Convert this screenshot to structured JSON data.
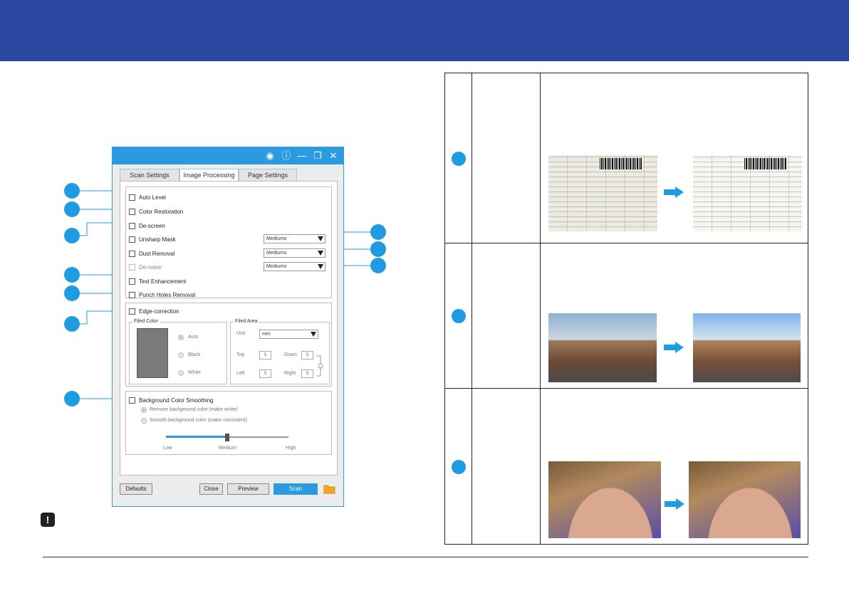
{
  "dialog": {
    "tabs": [
      "Scan Settings",
      "Image Processing",
      "Page Settings"
    ],
    "options": {
      "auto_level": "Auto Level",
      "color_restoration": "Color Restoration",
      "de_screen": "De-screen",
      "unsharp_mask": "Unsharp Mask",
      "dust_removal": "Dust Removal",
      "de_noise": "De-noise",
      "text_enhancement": "Text Enhancement",
      "punch_holes_removal": "Punch Holes Removal",
      "edge_correction": "Edge-correction",
      "background_color_smoothing": "Background Color Smoothing"
    },
    "dropdowns": {
      "unsharp_mask": "Mediums",
      "dust_removal": "Mediums",
      "de_noise": "Mediumx"
    },
    "edge": {
      "filled_color_label": "Filed Color",
      "filled_area_label": "Filed Area",
      "radios": [
        "Auto",
        "Black",
        "White"
      ],
      "selected_radio": "Auto",
      "unit_label": "Unit",
      "unit_value": "mm",
      "top_label": "Top",
      "top_value": "5",
      "down_label": "Down",
      "down_value": "5",
      "left_label": "Left",
      "left_value": "5",
      "right_label": "Right",
      "right_value": "5",
      "swatch_color": "#7a7a7a"
    },
    "background": {
      "option_remove": "Remove background color (make white)",
      "option_smooth": "Smooth background color (make consistent)",
      "slider_low": "Low",
      "slider_medium": "Medium",
      "slider_high": "High",
      "slider_level": 0.5
    },
    "buttons": {
      "defaults": "Defaults",
      "close": "Close",
      "preview": "Preview",
      "scan": "Scan"
    }
  },
  "colors": {
    "header": "#2a48a0",
    "accent": "#2b9ae0",
    "marker": "#1f9be2"
  }
}
